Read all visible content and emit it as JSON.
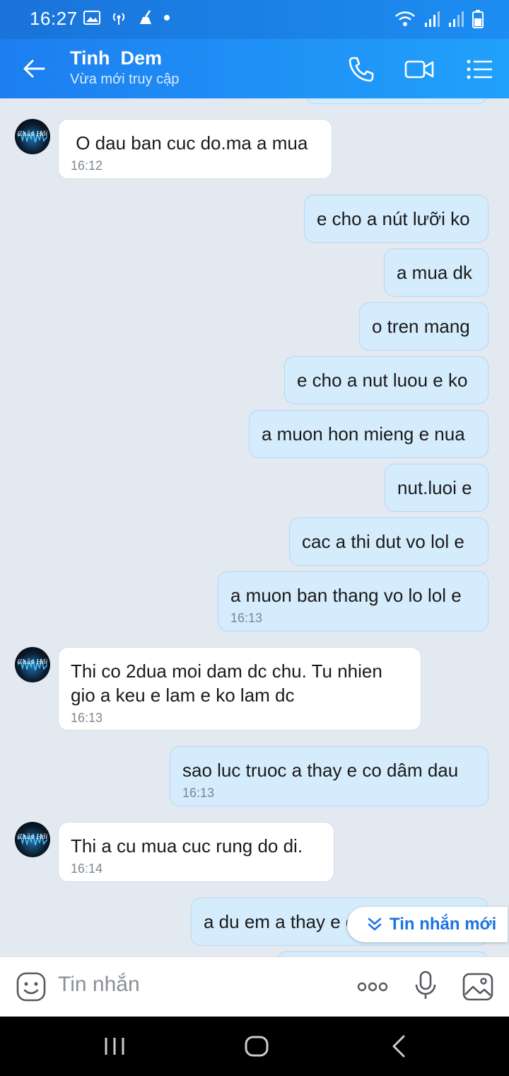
{
  "status_bar": {
    "time": "16:27"
  },
  "header": {
    "name": "Tinh  Dem",
    "status": "Vừa mới truy cập"
  },
  "contact_avatar_label": "Chân Hồi",
  "messages": [
    {
      "dir": "in",
      "text": " O dau ban cuc do.ma a mua",
      "time": "16:12"
    },
    {
      "dir": "out",
      "text": "e cho a nút lưỡi ko",
      "time": ""
    },
    {
      "dir": "out",
      "text": "a mua dk",
      "time": ""
    },
    {
      "dir": "out",
      "text": "o tren mang",
      "time": ""
    },
    {
      "dir": "out",
      "text": "e cho a nut luou e ko",
      "time": ""
    },
    {
      "dir": "out",
      "text": "a muon hon mieng e nua",
      "time": ""
    },
    {
      "dir": "out",
      "text": "nut.luoi e",
      "time": ""
    },
    {
      "dir": "out",
      "text": "cac a thi dut vo lol e",
      "time": ""
    },
    {
      "dir": "out",
      "text": "a muon ban thang vo lo lol e",
      "time": "16:13"
    },
    {
      "dir": "in",
      "text": "Thi co 2dua moi dam dc chu. Tu nhien\ngio a keu e lam e ko lam dc",
      "time": "16:13"
    },
    {
      "dir": "out",
      "text": "sao luc truoc a thay e co dâm dau",
      "time": "16:13"
    },
    {
      "dir": "in",
      "text": "Thi a cu mua cuc rung do di.",
      "time": "16:14"
    },
    {
      "dir": "out",
      "text": "a du em a thay e co dam",
      "time": ""
    }
  ],
  "new_message_pill": "Tin nhắn mới",
  "input": {
    "placeholder": "Tin nhắn"
  },
  "colors": {
    "header": "#1d7ef0",
    "out_bubble": "#d5ecfd",
    "in_bubble": "#ffffff",
    "chat_bg": "#e2e9f1",
    "accent": "#1b74e4"
  }
}
